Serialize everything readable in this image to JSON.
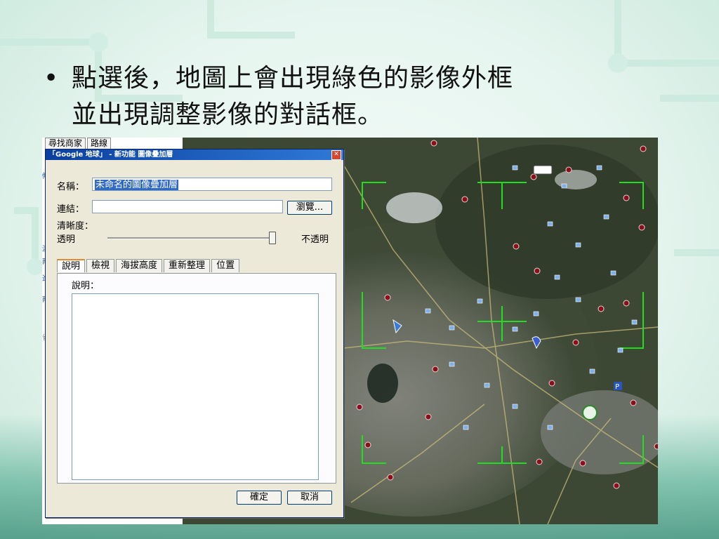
{
  "slide": {
    "bullet": "•",
    "line1": "點選後，地圖上會出現綠色的影像外框",
    "line2": "並出現調整影像的對話框。"
  },
  "sidebar": {
    "tabs": [
      "尋找商家",
      "路線"
    ],
    "fragments": [
      "傾",
      "清",
      "南",
      "進",
      "南",
      "省"
    ]
  },
  "dialog": {
    "title": "「Google 地球」 - 新功能 圖像疊加層",
    "close_icon": "close-icon",
    "name_label": "名稱：",
    "name_value": "未命名的圖像疊加層",
    "link_label": "連結：",
    "link_value": "",
    "browse_label": "瀏覽...",
    "clarity_label": "清晰度：",
    "transparent_label": "透明",
    "opaque_label": "不透明",
    "opacity": 1.0,
    "tabs": [
      "說明",
      "檢視",
      "海拔高度",
      "重新整理",
      "位置"
    ],
    "active_tab": "說明",
    "description_label": "說明：",
    "description_value": "",
    "ok_label": "確定",
    "cancel_label": "取消"
  },
  "colors": {
    "titlebar": "#0a3fa0",
    "selection": "#316ac5",
    "overlay_frame": "#22dd22",
    "placemark": "#8a0f1a"
  }
}
